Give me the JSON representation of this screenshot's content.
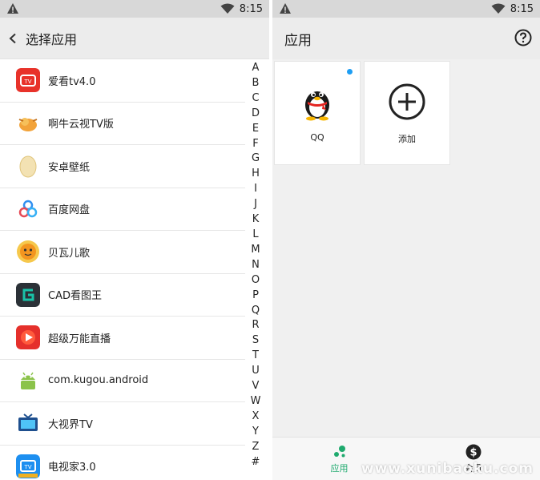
{
  "left": {
    "status": {
      "time": "8:15"
    },
    "toolbar": {
      "title": "选择应用"
    },
    "apps": [
      {
        "label": "爱看tv4.0",
        "icon": "aikan-tv-icon"
      },
      {
        "label": "啊牛云视TV版",
        "icon": "aniu-tv-icon"
      },
      {
        "label": "安卓壁纸",
        "icon": "egg-wallpaper-icon"
      },
      {
        "label": "百度网盘",
        "icon": "baidu-netdisk-icon"
      },
      {
        "label": "贝瓦儿歌",
        "icon": "beiwa-songs-icon"
      },
      {
        "label": "CAD看图王",
        "icon": "cad-viewer-icon"
      },
      {
        "label": "超级万能直播",
        "icon": "super-live-icon"
      },
      {
        "label": "com.kugou.android",
        "icon": "android-robot-icon"
      },
      {
        "label": "大视界TV",
        "icon": "dashijie-tv-icon"
      },
      {
        "label": "电视家3.0",
        "icon": "dianshijia-tv-icon"
      }
    ],
    "alphabet": [
      "A",
      "B",
      "C",
      "D",
      "E",
      "F",
      "G",
      "H",
      "I",
      "J",
      "K",
      "L",
      "M",
      "N",
      "O",
      "P",
      "Q",
      "R",
      "S",
      "T",
      "U",
      "V",
      "W",
      "X",
      "Y",
      "Z",
      "#"
    ]
  },
  "right": {
    "status": {
      "time": "8:15"
    },
    "toolbar": {
      "title": "应用"
    },
    "tiles": [
      {
        "label": "QQ"
      },
      {
        "label": "添加"
      }
    ],
    "nav": [
      {
        "label": "应用"
      },
      {
        "label": "会员"
      }
    ],
    "watermark": "www.xunibaoku.com"
  },
  "colors": {
    "accent_green": "#1faa6e",
    "dot_blue": "#1e9ef3"
  }
}
